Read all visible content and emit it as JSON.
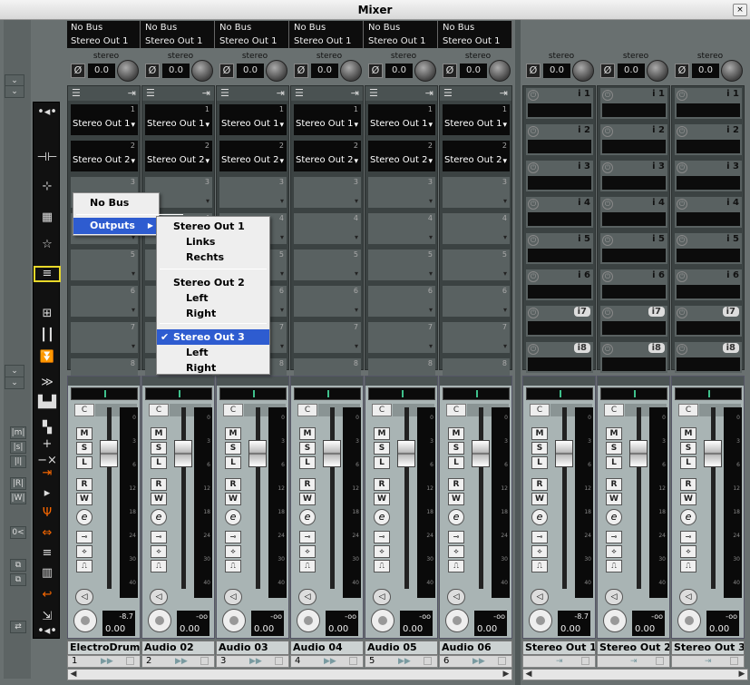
{
  "window": {
    "title": "Mixer",
    "close": "×"
  },
  "colors": {
    "highlight": "#2e5cd0",
    "meter_green": "#3ec08b",
    "selected_outline": "#e8d82a",
    "orange": "#ff6a00"
  },
  "channels": [
    {
      "name": "ElectroDrums",
      "num": "1",
      "bus1": "No Bus",
      "bus2": "Stereo Out 1",
      "pan_label": "stereo",
      "pan_val": "0.0",
      "peak": "-8.7",
      "vol": "0.00",
      "fader_pos": 0.78
    },
    {
      "name": "Audio 02",
      "num": "2",
      "bus1": "No Bus",
      "bus2": "Stereo Out 1",
      "pan_label": "stereo",
      "pan_val": "0.0",
      "peak": "-oo",
      "vol": "0.00",
      "fader_pos": 0.78
    },
    {
      "name": "Audio 03",
      "num": "3",
      "bus1": "No Bus",
      "bus2": "Stereo Out 1",
      "pan_label": "stereo",
      "pan_val": "0.0",
      "peak": "-oo",
      "vol": "0.00",
      "fader_pos": 0.78
    },
    {
      "name": "Audio 04",
      "num": "4",
      "bus1": "No Bus",
      "bus2": "Stereo Out 1",
      "pan_label": "stereo",
      "pan_val": "0.0",
      "peak": "-oo",
      "vol": "0.00",
      "fader_pos": 0.78
    },
    {
      "name": "Audio 05",
      "num": "5",
      "bus1": "No Bus",
      "bus2": "Stereo Out 1",
      "pan_label": "stereo",
      "pan_val": "0.0",
      "peak": "-oo",
      "vol": "0.00",
      "fader_pos": 0.78
    },
    {
      "name": "Audio 06",
      "num": "6",
      "bus1": "No Bus",
      "bus2": "Stereo Out 1",
      "pan_label": "stereo",
      "pan_val": "0.0",
      "peak": "-oo",
      "vol": "0.00",
      "fader_pos": 0.78
    }
  ],
  "outputs": [
    {
      "name": "Stereo Out 1",
      "pan_label": "stereo",
      "pan_val": "0.0",
      "peak": "-8.7",
      "vol": "0.00"
    },
    {
      "name": "Stereo Out 2",
      "pan_label": "stereo",
      "pan_val": "0.0",
      "peak": "-oo",
      "vol": "0.00"
    },
    {
      "name": "Stereo Out 3",
      "pan_label": "stereo",
      "pan_val": "0.0",
      "peak": "-oo",
      "vol": "0.00"
    }
  ],
  "routing_slots": {
    "slot1": "Stereo Out 1",
    "slot2": "Stereo Out 2",
    "slot3": "Stereo Out 3",
    "n1": "1",
    "n2": "2",
    "n3": "3",
    "n4": "4",
    "n5": "5",
    "n6": "6",
    "n7": "7",
    "n8": "8"
  },
  "insert_labels": [
    "i 1",
    "i 2",
    "i 3",
    "i 4",
    "i 5",
    "i 6",
    "i7",
    "i8"
  ],
  "buttons": {
    "mute": "M",
    "solo": "S",
    "listen": "L",
    "read": "R",
    "write": "W",
    "edit": "e",
    "c": "C",
    "phase": "Ø"
  },
  "meter_scale": [
    "0",
    "3",
    "6",
    "12",
    "18",
    "24",
    "30",
    "40"
  ],
  "menu": {
    "no_bus": "No Bus",
    "outputs": "Outputs",
    "sub": [
      {
        "label": "Stereo Out 1",
        "indent": false
      },
      {
        "label": "Links",
        "indent": true
      },
      {
        "label": "Rechts",
        "indent": true
      },
      {
        "label": "Stereo Out 2",
        "indent": false
      },
      {
        "label": "Left",
        "indent": true
      },
      {
        "label": "Right",
        "indent": true
      },
      {
        "label": "Stereo Out 3",
        "indent": false,
        "checked": true
      },
      {
        "label": "Left",
        "indent": true
      },
      {
        "label": "Right",
        "indent": true
      }
    ],
    "check": "✔",
    "arrow": "▶"
  }
}
